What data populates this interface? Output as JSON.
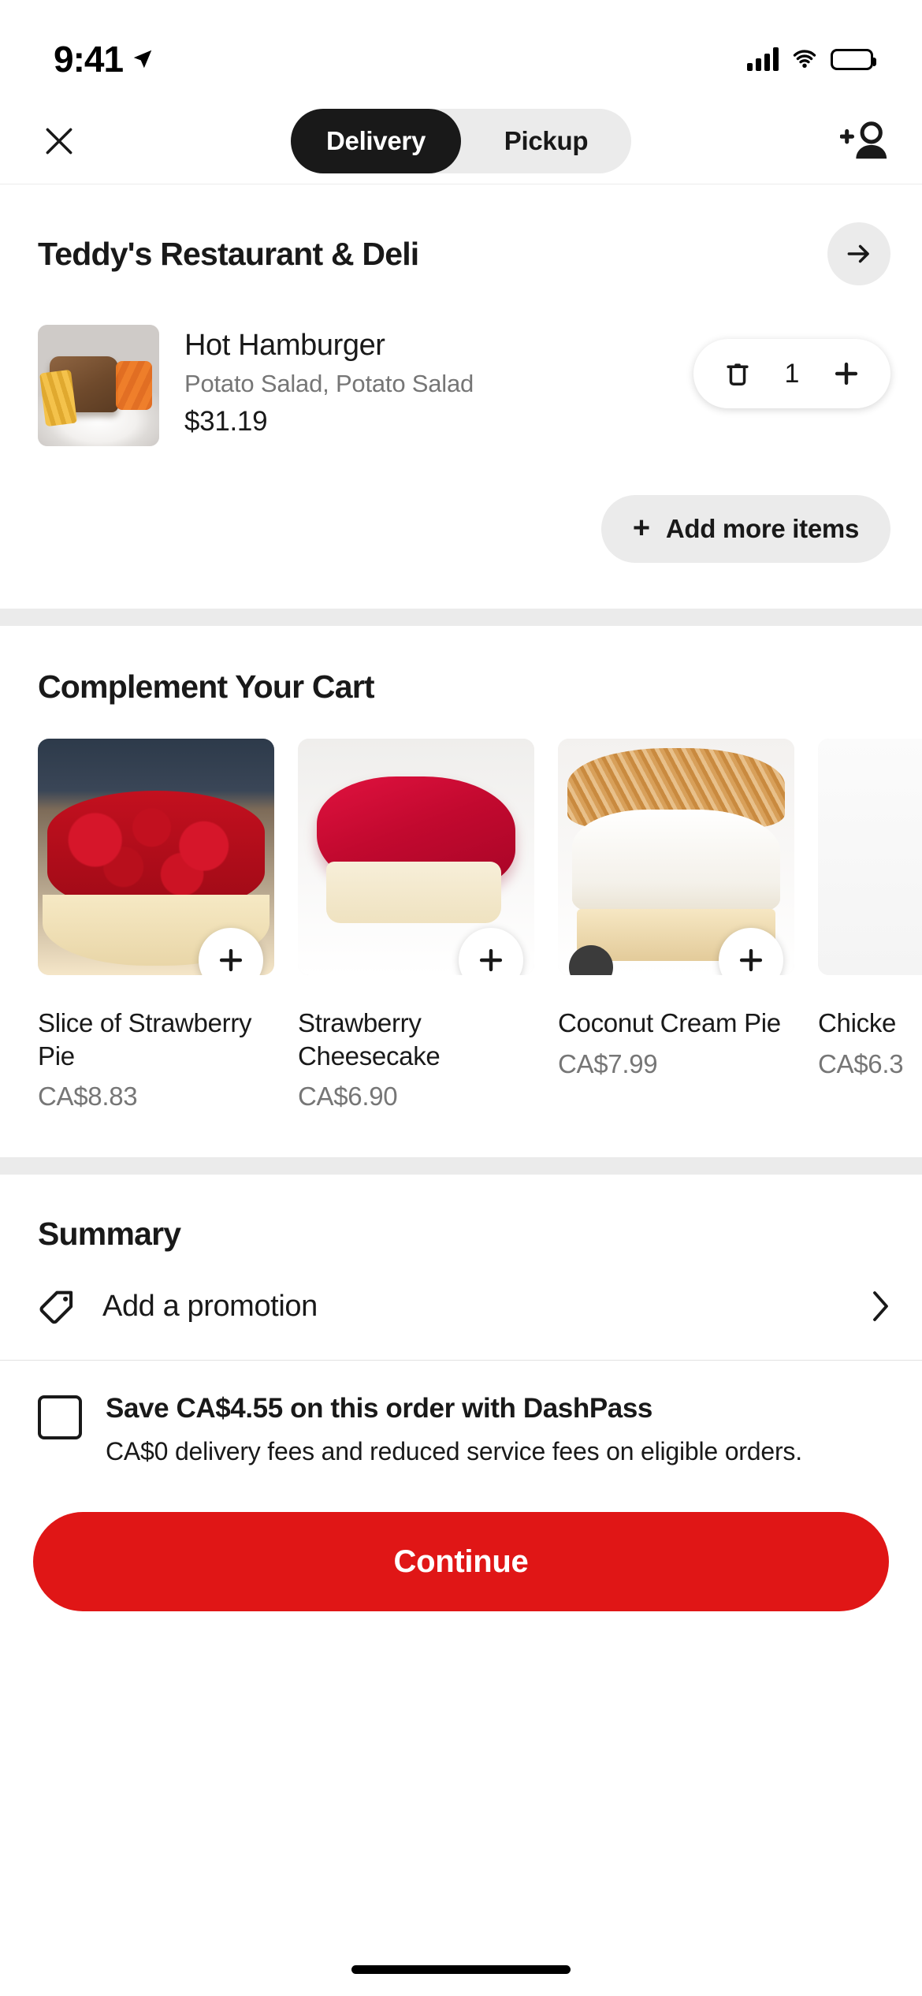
{
  "status_bar": {
    "time": "9:41",
    "location_icon": "location-arrow-icon",
    "signal_icon": "cellular-signal-icon",
    "wifi_icon": "wifi-icon",
    "battery_icon": "battery-full-icon"
  },
  "header": {
    "close_icon": "close-x-icon",
    "add_person_icon": "add-person-icon",
    "toggle": {
      "options": [
        "Delivery",
        "Pickup"
      ],
      "selected": "Delivery"
    }
  },
  "store": {
    "name": "Teddy's Restaurant & Deli",
    "arrow_icon": "arrow-right-icon"
  },
  "cart": {
    "items": [
      {
        "name": "Hot Hamburger",
        "options": "Potato Salad, Potato Salad",
        "price": "$31.19",
        "quantity": "1",
        "delete_icon": "trash-icon",
        "increase_icon": "plus-icon"
      }
    ],
    "add_more_label": "Add more items",
    "add_more_icon": "plus-icon"
  },
  "complement": {
    "title": "Complement Your Cart",
    "items": [
      {
        "name": "Slice of Strawberry Pie",
        "price": "CA$8.83",
        "add_icon": "plus-icon"
      },
      {
        "name": "Strawberry Cheesecake",
        "price": "CA$6.90",
        "add_icon": "plus-icon"
      },
      {
        "name": "Coconut Cream Pie",
        "price": "CA$7.99",
        "add_icon": "plus-icon"
      },
      {
        "name": "Chicke",
        "price": "CA$6.3",
        "add_icon": "plus-icon"
      }
    ]
  },
  "summary": {
    "title": "Summary",
    "promotion": {
      "label": "Add a promotion",
      "tag_icon": "tag-icon",
      "chevron_icon": "chevron-right-icon"
    },
    "dashpass": {
      "checked": false,
      "title": "Save CA$4.55 on this order with DashPass",
      "subtitle": "CA$0 delivery fees and reduced service fees on eligible orders."
    }
  },
  "footer": {
    "continue_label": "Continue",
    "continue_color": "#e01616"
  }
}
